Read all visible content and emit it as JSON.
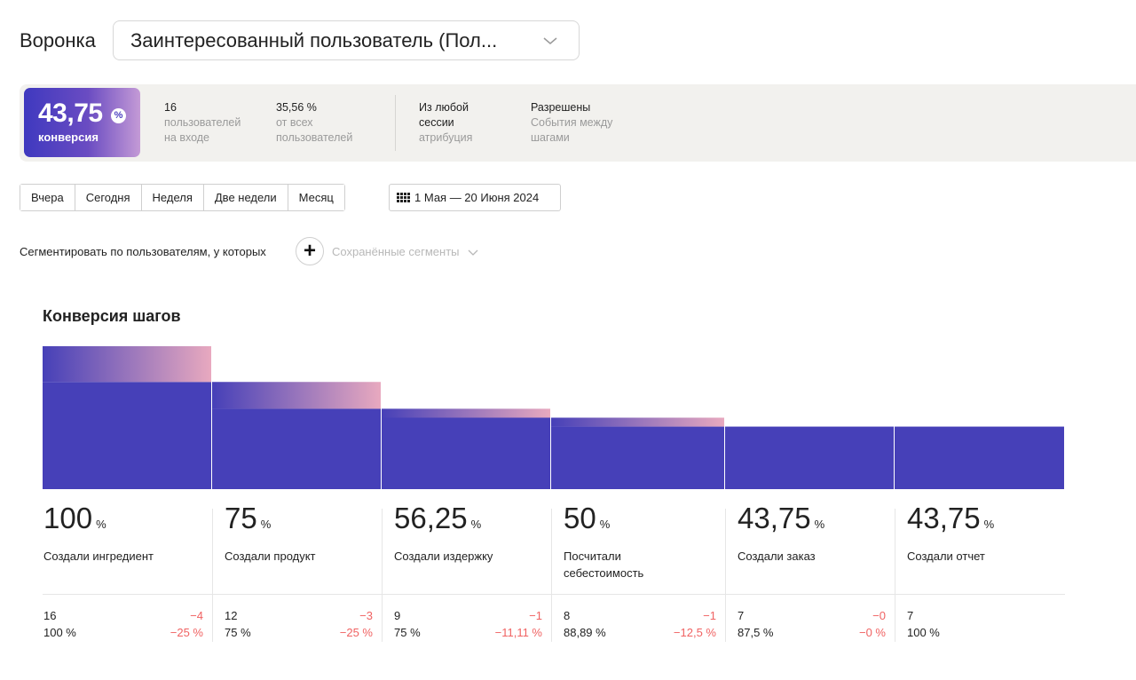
{
  "header": {
    "label": "Воронка",
    "selected_funnel": "Заинтересованный пользователь (Пол..."
  },
  "summary": {
    "conversion_value": "43,75",
    "conversion_label": "конверсия",
    "entry_users_value": "16",
    "entry_users_sub1": "пользователей",
    "entry_users_sub2": "на входе",
    "share_value": "35,56 %",
    "share_sub1": "от всех",
    "share_sub2": "пользователей",
    "attribution_value1": "Из любой",
    "attribution_value2": "сессии",
    "attribution_sub": "атрибуция",
    "events_value": "Разрешены",
    "events_sub1": "События между",
    "events_sub2": "шагами"
  },
  "periods": [
    "Вчера",
    "Сегодня",
    "Неделя",
    "Две недели",
    "Месяц"
  ],
  "date_range": "1 Мая — 20 Июня 2024",
  "segments": {
    "text": "Сегментировать по пользователям, у которых",
    "saved_label": "Сохранённые сегменты"
  },
  "colors": {
    "bar": "#4640b8",
    "gradient_start": "#4640b8",
    "gradient_end": "#e8a9bf",
    "negative": "#f06262"
  },
  "chart_data": {
    "type": "bar",
    "title": "Конверсия шагов",
    "categories": [
      "Создали ингредиент",
      "Создали продукт",
      "Создали издержку",
      "Посчитали себестоимость",
      "Создали заказ",
      "Создали отчет"
    ],
    "values": [
      100,
      75,
      56.25,
      50,
      43.75,
      43.75
    ],
    "value_labels": [
      "100",
      "75",
      "56,25",
      "50",
      "43,75",
      "43,75"
    ],
    "unit": "%",
    "name_lines": [
      [
        "Создали ингредиент"
      ],
      [
        "Создали продукт"
      ],
      [
        "Создали издержку"
      ],
      [
        "Посчитали",
        "себестоимость"
      ],
      [
        "Создали заказ"
      ],
      [
        "Создали отчет"
      ]
    ],
    "users": [
      "16",
      "12",
      "9",
      "8",
      "7",
      "7"
    ],
    "step_conversion": [
      "100 %",
      "75 %",
      "75 %",
      "88,89 %",
      "87,5 %",
      "100 %"
    ],
    "drop_users": [
      "−4",
      "−3",
      "−1",
      "−1",
      "−0",
      ""
    ],
    "drop_percent": [
      "−25 %",
      "−25 %",
      "−11,11 %",
      "−12,5 %",
      "−0 %",
      ""
    ],
    "ylim": [
      0,
      100
    ]
  }
}
